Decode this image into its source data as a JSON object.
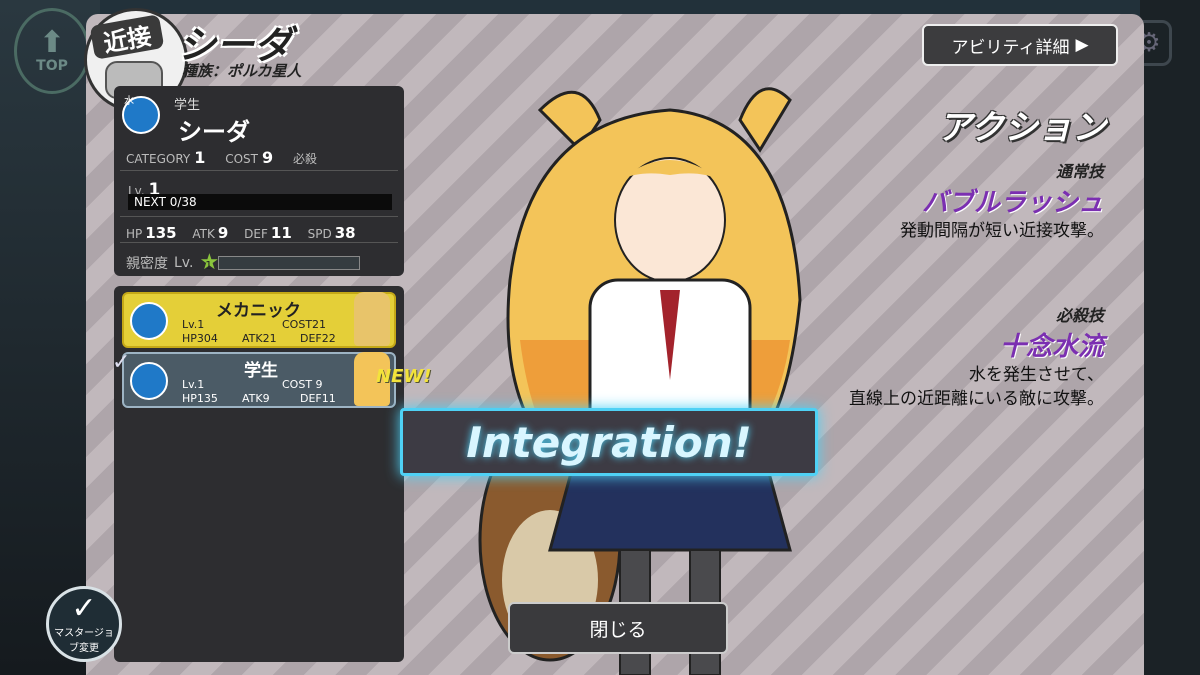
{
  "nav": {
    "top_label": "TOP"
  },
  "header": {
    "class_badge": "近接",
    "char_name": "シーダ",
    "race": "種族：ポルカ星人",
    "ability_button": "アビリティ詳細"
  },
  "stats": {
    "element_tag": "水",
    "range_tag": "近",
    "class_name": "学生",
    "name": "シーダ",
    "category_label": "CATEGORY",
    "category_value": "1",
    "cost_label": "COST",
    "cost_value": "9",
    "special_label": "必殺",
    "level_label": "Lv.",
    "level_value": "1",
    "next_text": "NEXT 0/38",
    "hp_label": "HP",
    "hp": "135",
    "atk_label": "ATK",
    "atk": "9",
    "def_label": "DEF",
    "def": "11",
    "spd_label": "SPD",
    "spd": "38",
    "affinity_label": "親密度",
    "affinity_level": "Lv.",
    "affinity_star": "1"
  },
  "jobs": [
    {
      "name": "メカニック",
      "lv": "Lv.1",
      "cost": "COST21",
      "hp": "HP304",
      "atk": "ATK21",
      "def": "DEF22"
    },
    {
      "name": "学生",
      "lv": "Lv.1",
      "cost": "COST 9",
      "hp": "HP135",
      "atk": "ATK9",
      "def": "DEF11"
    }
  ],
  "new_tag": "NEW!",
  "action": {
    "title": "アクション",
    "normal_label": "通常技",
    "normal_name": "バブルラッシュ",
    "normal_desc": "発動間隔が短い近接攻撃。",
    "special_label": "必殺技",
    "special_name": "十念水流",
    "special_desc_1": "水を発生させて、",
    "special_desc_2": "直線上の近距離にいる敵に攻撃。"
  },
  "popup": {
    "integration": "Integration!"
  },
  "close_button": "閉じる",
  "master_button": "マスタージョブ変更",
  "colors": {
    "accent": "#4fd1f5",
    "tech": "#7b2fb1",
    "job_selected": "#e4cf38"
  }
}
